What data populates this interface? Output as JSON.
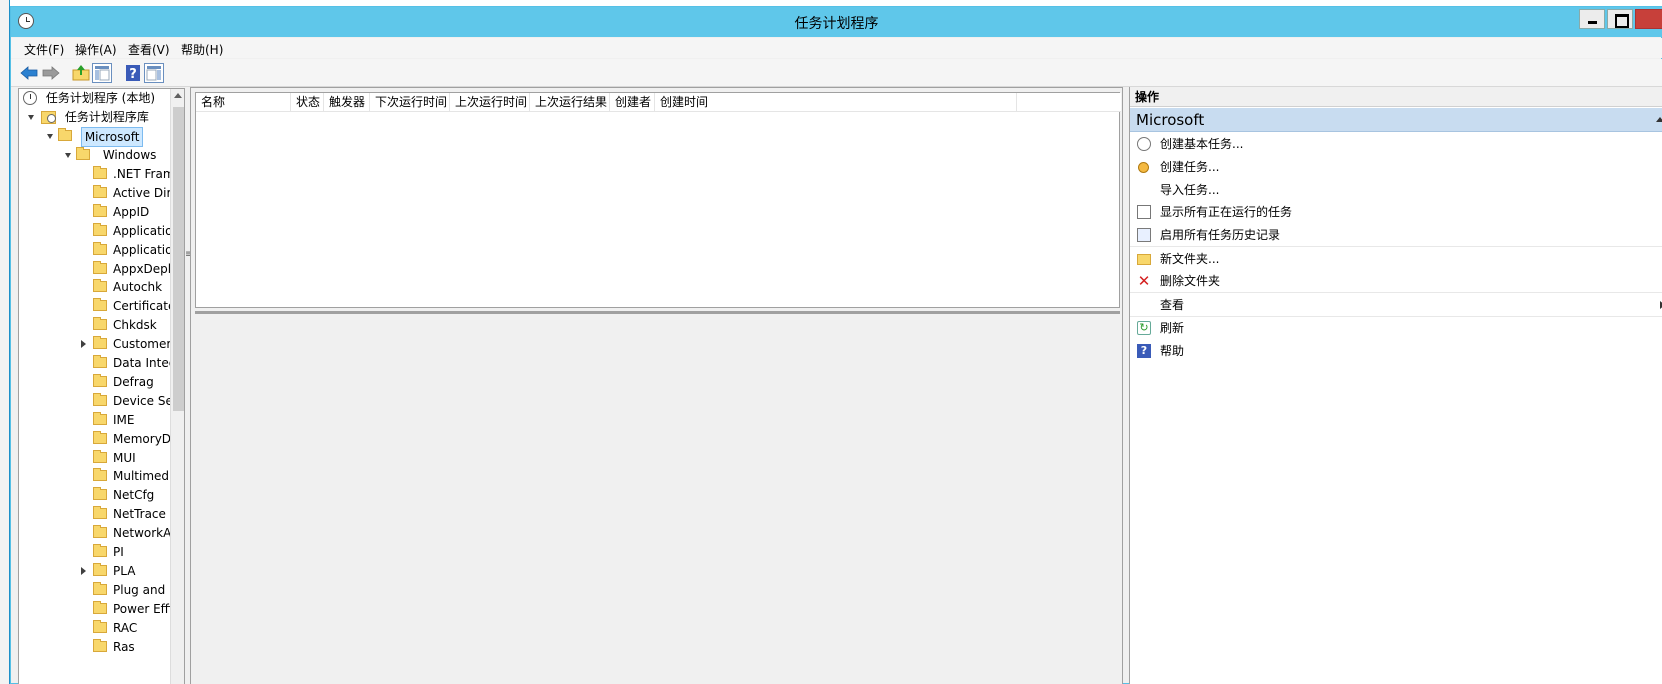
{
  "window": {
    "title": "任务计划程序"
  },
  "menubar": {
    "items": [
      "文件(F)",
      "操作(A)",
      "查看(V)",
      "帮助(H)"
    ]
  },
  "toolbar": {
    "icons": [
      "back-arrow-icon",
      "forward-arrow-icon",
      "up-folder-icon",
      "show-tree-icon",
      "help-icon",
      "show-action-pane-icon"
    ]
  },
  "tree": {
    "root": "任务计划程序 (本地)",
    "library": "任务计划程序库",
    "microsoft": "Microsoft",
    "windows": "Windows",
    "folders": [
      ".NET Framework",
      "Active Directory",
      "AppID",
      "Application",
      "Application",
      "AppxDeployment",
      "Autochk",
      "CertificateServices",
      "Chkdsk",
      "Customer",
      "Data Integrity",
      "Defrag",
      "Device Setup",
      "IME",
      "MemoryDiagnostic",
      "MUI",
      "Multimedia",
      "NetCfg",
      "NetTrace",
      "NetworkAccess",
      "PI",
      "PLA",
      "Plug and Play",
      "Power Efficiency",
      "RAC",
      "Ras"
    ]
  },
  "list": {
    "columns": [
      "名称",
      "状态",
      "触发器",
      "下次运行时间",
      "上次运行时间",
      "上次运行结果",
      "创建者",
      "创建时间"
    ]
  },
  "actions": {
    "header": "操作",
    "group": "Microsoft",
    "items": [
      {
        "label": "创建基本任务...",
        "icon": "create-basic-task-icon"
      },
      {
        "label": "创建任务...",
        "icon": "create-task-icon"
      },
      {
        "label": "导入任务...",
        "icon": ""
      },
      {
        "label": "显示所有正在运行的任务",
        "icon": "running-tasks-icon"
      },
      {
        "label": "启用所有任务历史记录",
        "icon": "task-history-icon"
      },
      {
        "label": "新文件夹...",
        "icon": "new-folder-icon"
      },
      {
        "label": "删除文件夹",
        "icon": "delete-icon"
      },
      {
        "label": "查看",
        "icon": ""
      },
      {
        "label": "刷新",
        "icon": "refresh-icon"
      },
      {
        "label": "帮助",
        "icon": "help-icon"
      }
    ]
  },
  "colors": {
    "titlebar": "#5fc7ea",
    "selection": "#cde8ff",
    "group_header": "#c8dcf0",
    "close_button": "#c7403a"
  }
}
